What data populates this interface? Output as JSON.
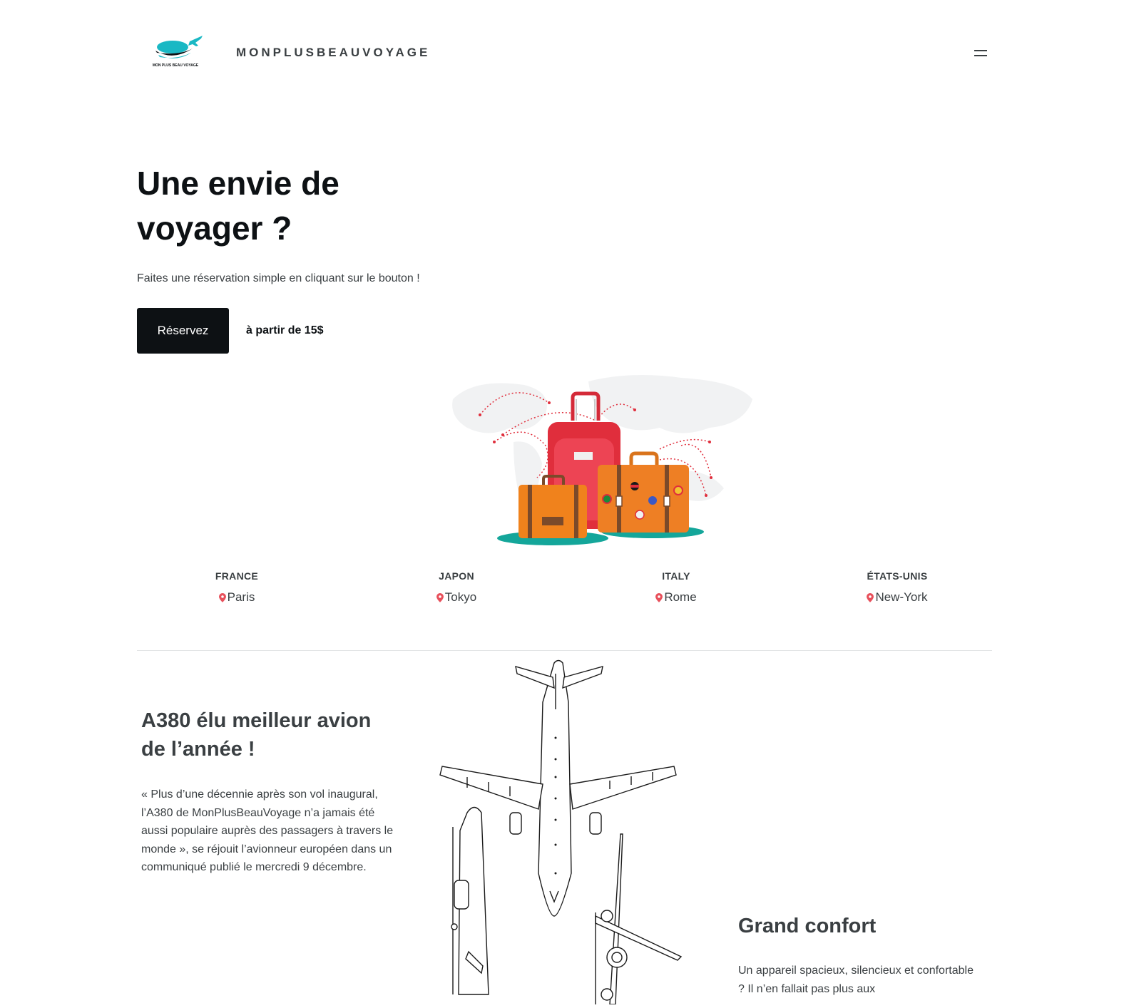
{
  "header": {
    "logo_text": "MON PLUS BEAU VOYAGE",
    "brand": "MONPLUSBEAUVOYAGE",
    "menu_icon": "hamburger-icon"
  },
  "hero": {
    "title_line1": "Une envie de",
    "title_line2": "voyager ?",
    "subtitle": "Faites une réservation simple en cliquant sur le bouton !",
    "cta_label": "Réservez",
    "price": "à partir de 15$"
  },
  "destinations": [
    {
      "country": "FRANCE",
      "city": "Paris"
    },
    {
      "country": "JAPON",
      "city": "Tokyo"
    },
    {
      "country": "ITALY",
      "city": "Rome"
    },
    {
      "country": "ÉTATS-UNIS",
      "city": "New-York"
    }
  ],
  "article": {
    "title_line1": "A380 élu meilleur avion",
    "title_line2": "de l’année !",
    "text": "« Plus d’une décennie après son vol inaugural, l’A380 de MonPlusBeauVoyage n’a jamais été aussi populaire auprès des passagers à travers le monde », se réjouit l’avionneur européen dans un communiqué publié le mercredi 9 décembre."
  },
  "comfort": {
    "title": "Grand confort",
    "text": "Un appareil spacieux, silencieux et confortable ? Il n’en fallait pas plus aux"
  },
  "colors": {
    "dark": "#0d1114",
    "text_gray": "#3a3f42",
    "logo_teal": "#1ab8c4",
    "pin_red": "#e8505b",
    "suitcase_red": "#e02e3c",
    "suitcase_orange": "#f08a24",
    "ground_teal": "#14a69a"
  }
}
